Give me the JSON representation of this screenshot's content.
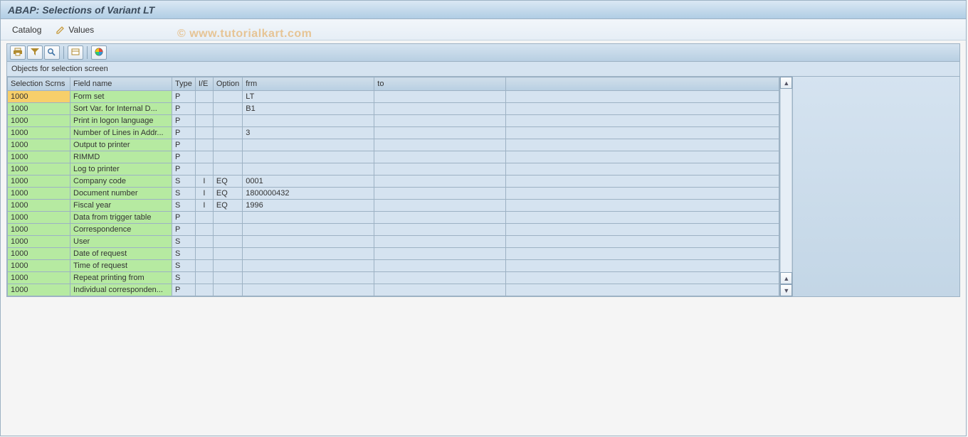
{
  "title": "ABAP: Selections of Variant LT",
  "watermark": "© www.tutorialkart.com",
  "menu": {
    "catalog": "Catalog",
    "values": "Values"
  },
  "toolbar": {
    "icons": {
      "print": "print-icon",
      "filter": "filter-icon",
      "find": "find-icon",
      "export": "export-icon",
      "colors": "colors-icon"
    }
  },
  "section_header": "Objects for selection screen",
  "columns": {
    "scrn": "Selection Scrns",
    "fname": "Field name",
    "type": "Type",
    "ie": "I/E",
    "opt": "Option",
    "frm": "frm",
    "to": "to"
  },
  "rows": [
    {
      "scrn": "1000",
      "fname": "Form set",
      "type": "P",
      "ie": "",
      "opt": "",
      "frm": "LT",
      "to": "",
      "selected": true
    },
    {
      "scrn": "1000",
      "fname": "Sort Var. for Internal D...",
      "type": "P",
      "ie": "",
      "opt": "",
      "frm": "B1",
      "to": ""
    },
    {
      "scrn": "1000",
      "fname": "Print in logon language",
      "type": "P",
      "ie": "",
      "opt": "",
      "frm": "",
      "to": ""
    },
    {
      "scrn": "1000",
      "fname": "Number of Lines in Addr...",
      "type": "P",
      "ie": "",
      "opt": "",
      "frm": "3",
      "to": ""
    },
    {
      "scrn": "1000",
      "fname": "Output to printer",
      "type": "P",
      "ie": "",
      "opt": "",
      "frm": "",
      "to": ""
    },
    {
      "scrn": "1000",
      "fname": "RIMMD",
      "type": "P",
      "ie": "",
      "opt": "",
      "frm": "",
      "to": ""
    },
    {
      "scrn": "1000",
      "fname": "Log to printer",
      "type": "P",
      "ie": "",
      "opt": "",
      "frm": "",
      "to": ""
    },
    {
      "scrn": "1000",
      "fname": "Company code",
      "type": "S",
      "ie": "I",
      "opt": "EQ",
      "frm": "0001",
      "to": ""
    },
    {
      "scrn": "1000",
      "fname": "Document number",
      "type": "S",
      "ie": "I",
      "opt": "EQ",
      "frm": "1800000432",
      "to": ""
    },
    {
      "scrn": "1000",
      "fname": "Fiscal year",
      "type": "S",
      "ie": "I",
      "opt": "EQ",
      "frm": "1996",
      "to": ""
    },
    {
      "scrn": "1000",
      "fname": "Data from trigger table",
      "type": "P",
      "ie": "",
      "opt": "",
      "frm": "",
      "to": ""
    },
    {
      "scrn": "1000",
      "fname": "Correspondence",
      "type": "P",
      "ie": "",
      "opt": "",
      "frm": "",
      "to": ""
    },
    {
      "scrn": "1000",
      "fname": "User",
      "type": "S",
      "ie": "",
      "opt": "",
      "frm": "",
      "to": ""
    },
    {
      "scrn": "1000",
      "fname": "Date of request",
      "type": "S",
      "ie": "",
      "opt": "",
      "frm": "",
      "to": ""
    },
    {
      "scrn": "1000",
      "fname": "Time of request",
      "type": "S",
      "ie": "",
      "opt": "",
      "frm": "",
      "to": ""
    },
    {
      "scrn": "1000",
      "fname": "Repeat printing from",
      "type": "S",
      "ie": "",
      "opt": "",
      "frm": "",
      "to": ""
    },
    {
      "scrn": "1000",
      "fname": "Individual corresponden...",
      "type": "P",
      "ie": "",
      "opt": "",
      "frm": "",
      "to": ""
    }
  ]
}
